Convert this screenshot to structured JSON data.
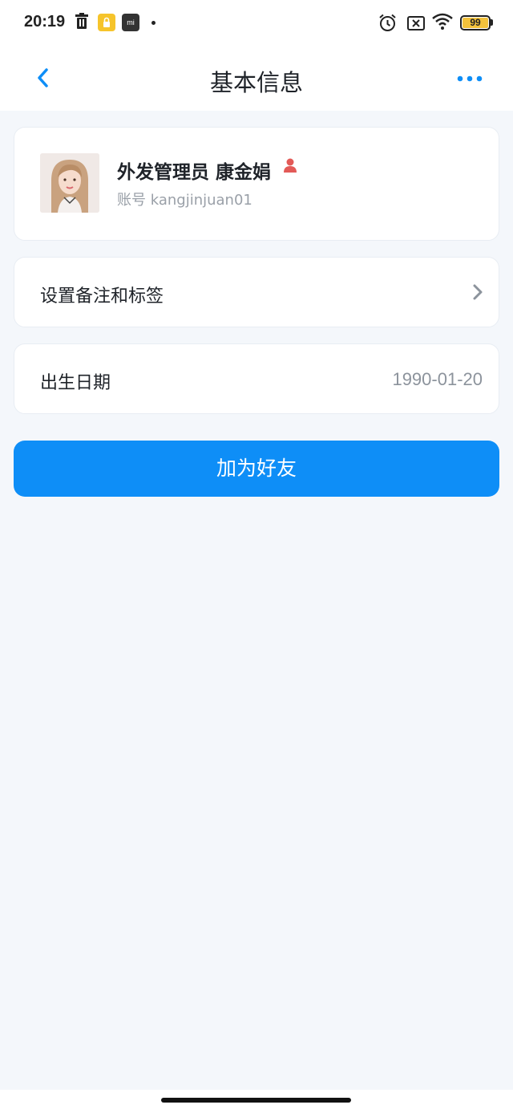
{
  "status_bar": {
    "time": "20:19",
    "battery_level": "99",
    "icons": [
      "trash-icon",
      "lock-app-icon",
      "mi-app-icon",
      "alarm-icon",
      "no-sim-icon",
      "wifi-icon",
      "battery-icon"
    ]
  },
  "nav": {
    "title": "基本信息",
    "back_icon": "chevron-left-icon",
    "more_icon": "more-dots-icon"
  },
  "profile": {
    "name": "外发管理员 康金娟",
    "account": "账号 kangjinjuan01",
    "badge_icon": "person-icon"
  },
  "rows": {
    "remark_label": "设置备注和标签",
    "birthday_label": "出生日期",
    "birthday_value": "1990-01-20"
  },
  "actions": {
    "add_friend_label": "加为好友"
  },
  "colors": {
    "accent": "#0e8ef7",
    "background": "#f4f7fb",
    "badge": "#e35a57"
  }
}
